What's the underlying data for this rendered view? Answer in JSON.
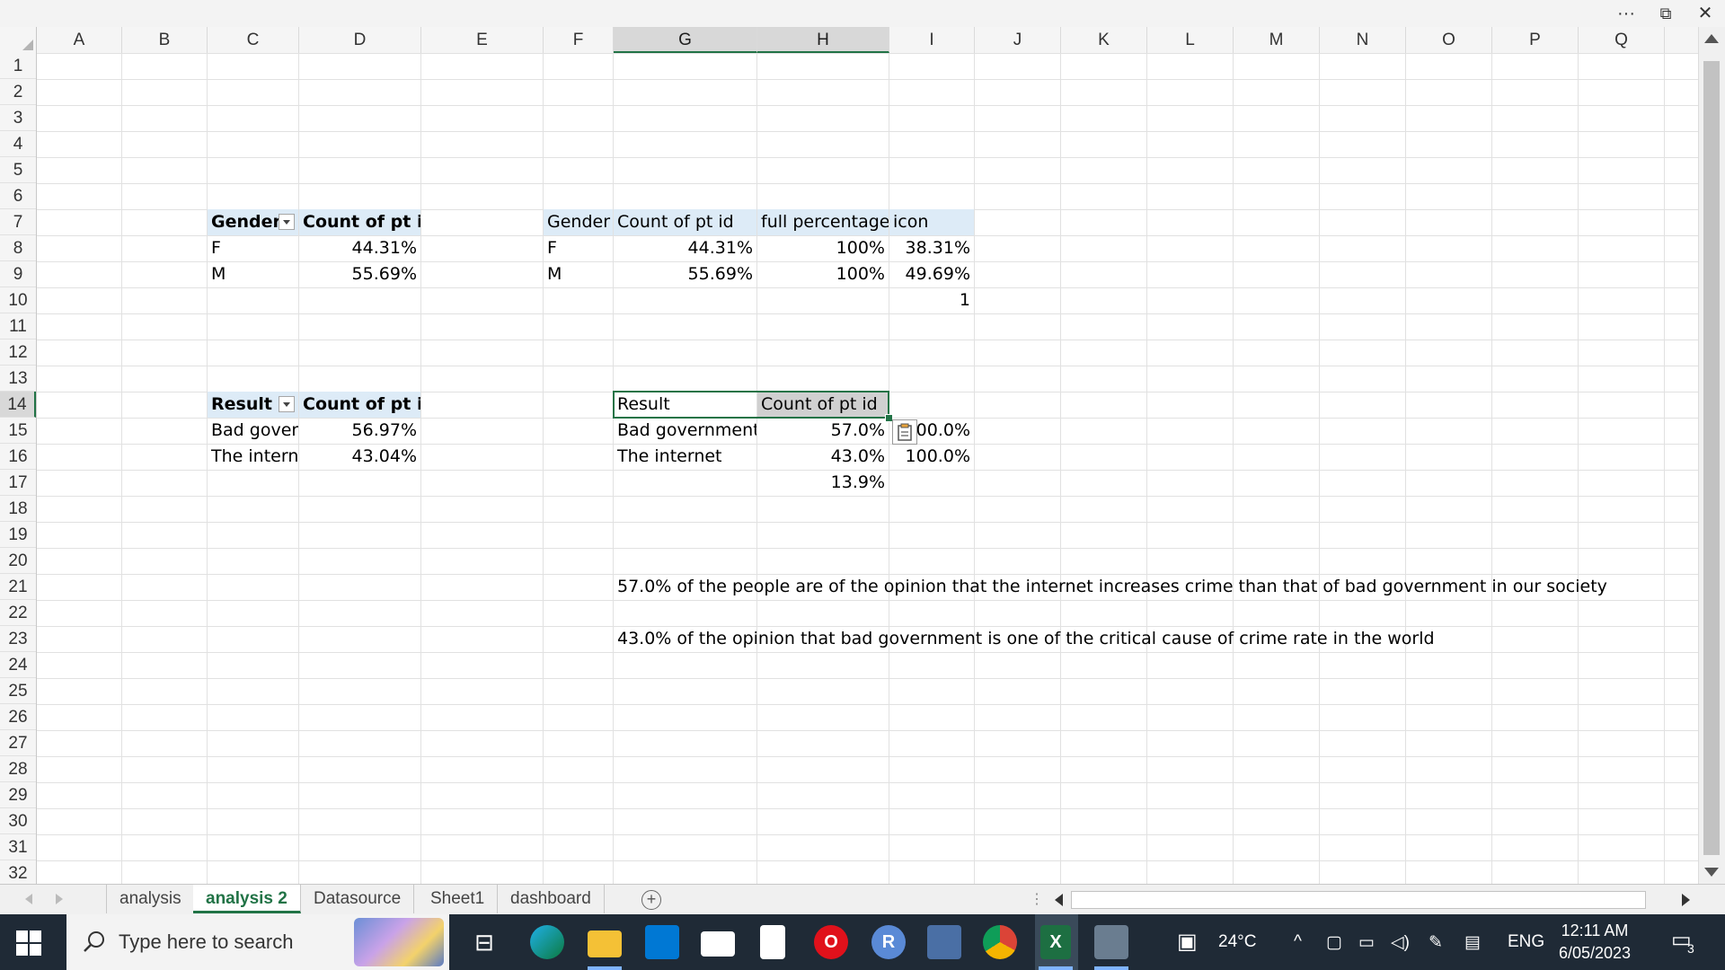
{
  "window": {
    "more_label": "···",
    "restore_label": "⧉",
    "close_label": "✕"
  },
  "columns": [
    "A",
    "B",
    "C",
    "D",
    "E",
    "F",
    "G",
    "H",
    "I",
    "J",
    "K",
    "L",
    "M",
    "N",
    "O",
    "P",
    "Q"
  ],
  "rows": [
    "1",
    "2",
    "3",
    "4",
    "5",
    "6",
    "7",
    "8",
    "9",
    "10",
    "11",
    "12",
    "13",
    "14",
    "15",
    "16",
    "17",
    "18",
    "19",
    "20",
    "21",
    "22",
    "23",
    "24",
    "25",
    "26",
    "27",
    "28",
    "29",
    "30",
    "31",
    "32"
  ],
  "pivot_gender": {
    "header_label": "Gender",
    "header_value": "Count of pt id",
    "rows": [
      {
        "label": "F",
        "value": "44.31%"
      },
      {
        "label": "M",
        "value": "55.69%"
      }
    ]
  },
  "gender_table": {
    "headers": [
      "Gender",
      "Count of pt id",
      "full percentage",
      "icon"
    ],
    "rows": [
      [
        "F",
        "44.31%",
        "100%",
        "38.31%"
      ],
      [
        "M",
        "55.69%",
        "100%",
        "49.69%"
      ]
    ],
    "extra_value": "1"
  },
  "pivot_result": {
    "header_label": "Result",
    "header_value": "Count of pt id",
    "rows": [
      {
        "label": "Bad goverr",
        "value": "56.97%"
      },
      {
        "label": "The interne",
        "value": "43.04%"
      }
    ]
  },
  "result_table": {
    "headers": [
      "Result",
      "Count of pt id"
    ],
    "rows": [
      {
        "label": "Bad government",
        "value": "57.0%",
        "extra": "00.0%"
      },
      {
        "label": "The internet",
        "value": "43.0%",
        "extra": "100.0%"
      }
    ],
    "extra_value": "13.9%"
  },
  "notes": [
    "57.0% of the people are of the opinion that the internet increases crime than that of bad government in our society",
    "43.0% of the opinion that bad government is one of the critical cause of crime rate in the world"
  ],
  "sheet_tabs": [
    "analysis",
    "analysis 2",
    "Datasource",
    "Sheet1",
    "dashboard"
  ],
  "active_tab": "analysis 2",
  "add_sheet_label": "+",
  "taskbar": {
    "search_placeholder": "Type here to search",
    "weather": "24°C",
    "language": "ENG",
    "time": "12:11 AM",
    "date": "6/05/2023",
    "notification_count": "3",
    "apps": [
      "task-view",
      "edge",
      "file-explorer",
      "store",
      "mail",
      "notepad",
      "opera",
      "r-studio",
      "remote-desktop",
      "chrome",
      "excel",
      "photos"
    ]
  },
  "colors": {
    "excel_green": "#217346",
    "pivot_header": "#ddebf7",
    "taskbar": "#1f2a36"
  }
}
